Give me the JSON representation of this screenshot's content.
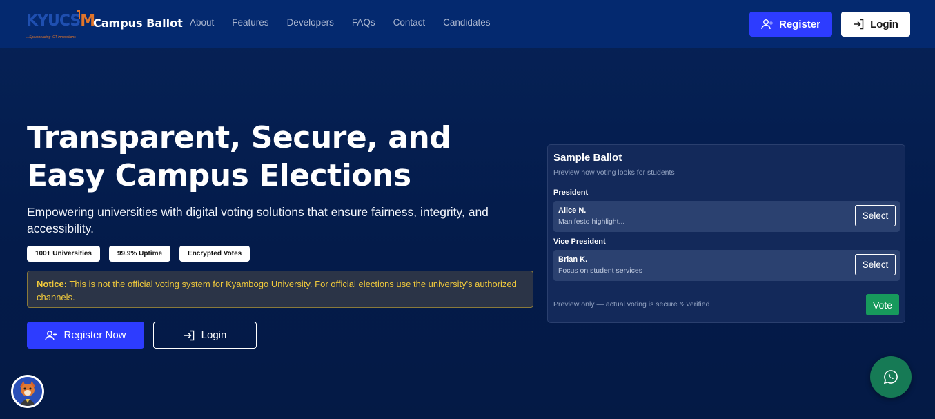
{
  "nav": {
    "logo_text": "KYUCS",
    "logo_m": "M",
    "logo_tagline": "...Spearheading ICT Innovations",
    "brand": "Campus Ballot",
    "links": [
      "About",
      "Features",
      "Developers",
      "FAQs",
      "Contact",
      "Candidates"
    ],
    "register_label": "Register",
    "login_label": "Login"
  },
  "hero": {
    "title": "Transparent, Secure, and Easy Campus Elections",
    "subtitle": "Empowering universities with digital voting solutions that ensure fairness, integrity, and accessibility.",
    "badges": [
      "100+ Universities",
      "99.9% Uptime",
      "Encrypted Votes"
    ],
    "notice_label": "Notice:",
    "notice_text": " This is not the official voting system for Kyambogo University. For official elections use the university's authorized channels.",
    "register_now_label": "Register Now",
    "login_label": "Login"
  },
  "ballot": {
    "title": "Sample Ballot",
    "subtitle": "Preview how voting looks for students",
    "positions": [
      {
        "label": "President",
        "candidate": "Alice N.",
        "description": "Manifesto highlight...",
        "button": "Select"
      },
      {
        "label": "Vice President",
        "candidate": "Brian K.",
        "description": "Focus on student services",
        "button": "Select"
      }
    ],
    "footer": "Preview only — actual voting is secure & verified",
    "vote_label": "Vote"
  },
  "colors": {
    "background": "#041b4a",
    "navbar": "#04296f",
    "accent": "#2d3cff",
    "vote_green": "#179a5c",
    "notice_text": "#f0c93c",
    "whatsapp": "#167a55"
  },
  "icons": {
    "register": "user-plus-icon",
    "login": "sign-in-icon",
    "whatsapp": "whatsapp-icon"
  }
}
